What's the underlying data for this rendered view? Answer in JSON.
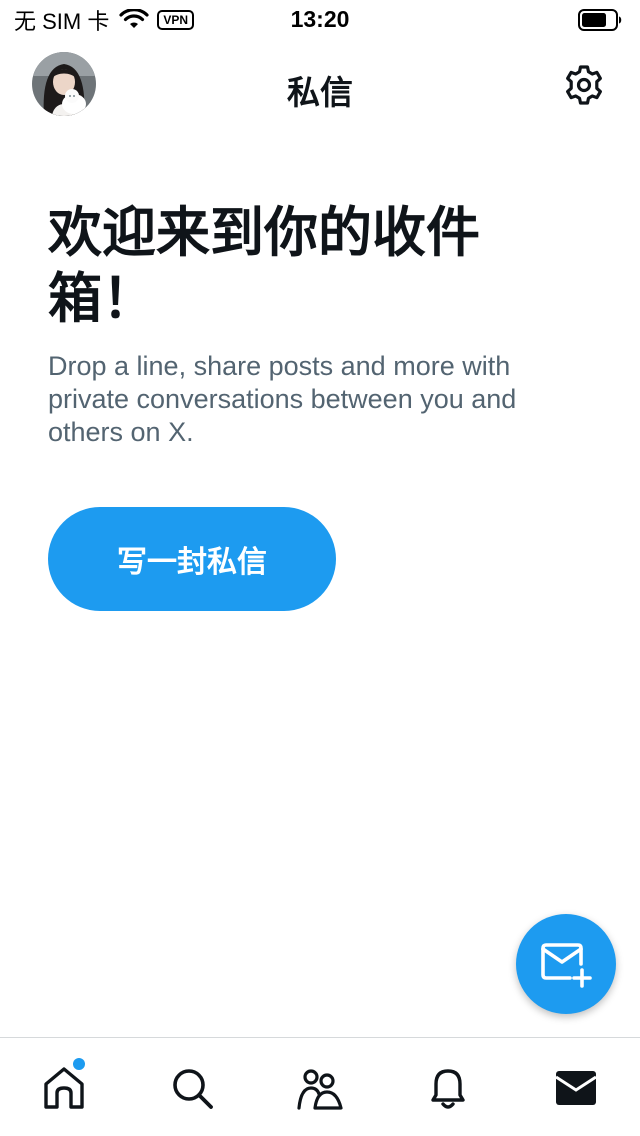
{
  "status_bar": {
    "carrier": "无 SIM 卡",
    "vpn": "VPN",
    "time": "13:20"
  },
  "header": {
    "title": "私信",
    "avatar": "user-avatar",
    "settings_icon": "gear-icon"
  },
  "main": {
    "heading": "欢迎来到你的收件箱！",
    "description": "Drop a line, share posts and more with private conversations between you and others on X.",
    "button_label": "写一封私信"
  },
  "fab": {
    "icon": "new-message-icon",
    "color": "#1d9bf0"
  },
  "tabbar": {
    "tabs": [
      {
        "icon": "home-icon",
        "has_dot": true
      },
      {
        "icon": "search-icon"
      },
      {
        "icon": "communities-icon"
      },
      {
        "icon": "bell-icon"
      },
      {
        "icon": "mail-icon",
        "active": true
      }
    ]
  },
  "colors": {
    "accent": "#1d9bf0",
    "text_primary": "#0f1419",
    "text_secondary": "#536471"
  }
}
